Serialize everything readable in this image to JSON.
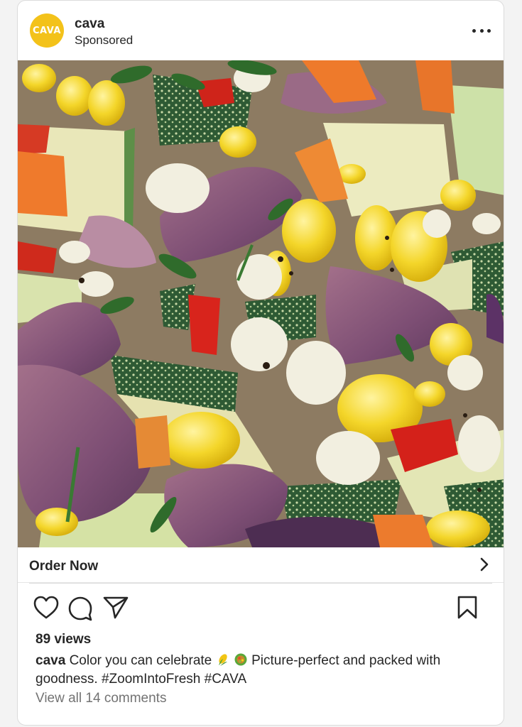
{
  "post": {
    "avatar_text": "CAVA",
    "username": "cava",
    "sponsored_label": "Sponsored",
    "image_subject": "roasted vegetable salad",
    "cta_label": "Order Now",
    "views": "89 views",
    "caption_user": "cava",
    "caption_part1": "Color you can celebrate",
    "caption_emoji_1": "corn-emoji",
    "caption_emoji_2": "salad-bowl-emoji",
    "caption_part2": "Picture-perfect and packed with goodness. #ZoomIntoFresh #CAVA",
    "comments_link": "View all 14 comments"
  },
  "colors": {
    "brand_yellow": "#f3c21a",
    "text": "#262626",
    "muted": "#737373"
  }
}
